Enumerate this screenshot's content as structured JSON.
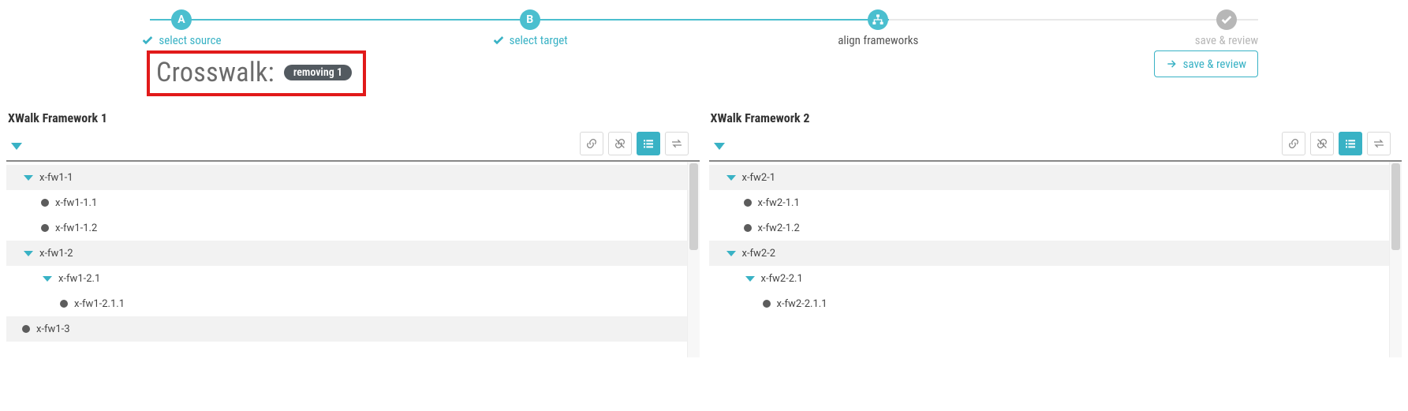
{
  "stepper": {
    "steps": [
      {
        "badge": "A",
        "label": "select source",
        "done": true,
        "color_badge": "#4bbfcf",
        "color_label": "#39b2c5"
      },
      {
        "badge": "B",
        "label": "select target",
        "done": true,
        "color_badge": "#4bbfcf",
        "color_label": "#39b2c5"
      },
      {
        "badge": "icon",
        "label": "align frameworks",
        "done": false,
        "color_badge": "#4bbfcf",
        "color_label": "#555555"
      },
      {
        "badge": "check",
        "label": "save & review",
        "done": false,
        "color_badge": "#b7b7b7",
        "color_label": "#b7b7b7"
      }
    ],
    "seg_colors": [
      "#4bbfcf",
      "#4bbfcf",
      "#e8e8e8"
    ]
  },
  "header": {
    "title": "Crosswalk:",
    "pill": "removing 1",
    "action": "save & review"
  },
  "panels": [
    {
      "title": "XWalk Framework 1",
      "tools": [
        "link",
        "unlink",
        "list",
        "swap"
      ],
      "active_tool": 2,
      "tree": [
        {
          "depth": 0,
          "kind": "branch",
          "label": "x-fw1-1"
        },
        {
          "depth": 1,
          "kind": "leaf",
          "label": "x-fw1-1.1"
        },
        {
          "depth": 1,
          "kind": "leaf",
          "label": "x-fw1-1.2"
        },
        {
          "depth": 0,
          "kind": "branch",
          "label": "x-fw1-2"
        },
        {
          "depth": 1,
          "kind": "branch",
          "label": "x-fw1-2.1"
        },
        {
          "depth": 2,
          "kind": "leaf",
          "label": "x-fw1-2.1.1"
        },
        {
          "depth": 0,
          "kind": "leaf",
          "label": "x-fw1-3"
        }
      ]
    },
    {
      "title": "XWalk Framework 2",
      "tools": [
        "link",
        "unlink",
        "list",
        "swap"
      ],
      "active_tool": 2,
      "tree": [
        {
          "depth": 0,
          "kind": "branch",
          "label": "x-fw2-1"
        },
        {
          "depth": 1,
          "kind": "leaf",
          "label": "x-fw2-1.1"
        },
        {
          "depth": 1,
          "kind": "leaf",
          "label": "x-fw2-1.2"
        },
        {
          "depth": 0,
          "kind": "branch",
          "label": "x-fw2-2"
        },
        {
          "depth": 1,
          "kind": "branch",
          "label": "x-fw2-2.1"
        },
        {
          "depth": 2,
          "kind": "leaf",
          "label": "x-fw2-2.1.1"
        }
      ]
    }
  ],
  "icons": {
    "link": "link-icon",
    "unlink": "unlink-icon",
    "list": "list-icon",
    "swap": "swap-icon",
    "check": "check-icon",
    "arrow": "arrow-right-icon",
    "org": "org-chart-icon"
  }
}
